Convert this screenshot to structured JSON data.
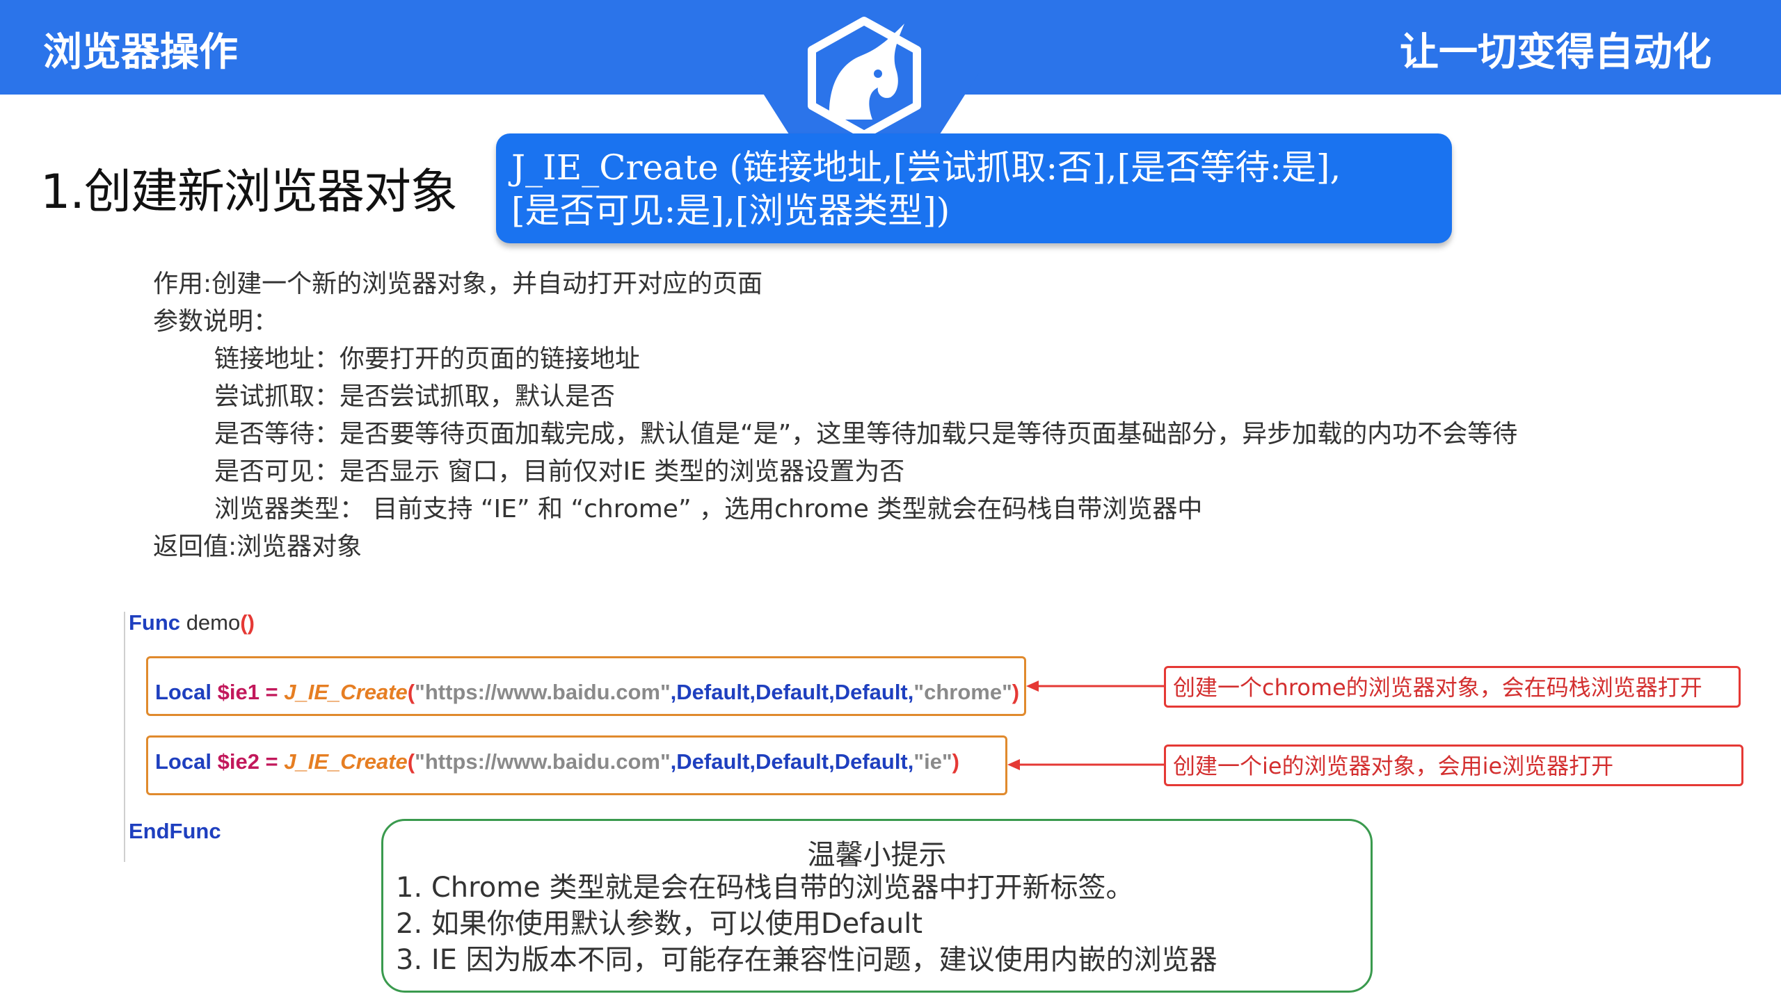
{
  "header": {
    "left_title": "浏览器操作",
    "right_title": "让一切变得自动化",
    "logo": "unicorn-logo-icon"
  },
  "section": {
    "title": "1.创建新浏览器对象",
    "signature_line1": "J_IE_Create (链接地址,[尝试抓取:否],[是否等待:是],",
    "signature_line2": "[是否可见:是],[浏览器类型])"
  },
  "description": {
    "purpose": "作用:创建一个新的浏览器对象，并自动打开对应的页面",
    "params_header": "参数说明：",
    "params": [
      "链接地址：你要打开的页面的链接地址",
      "尝试抓取：是否尝试抓取，默认是否",
      "是否等待：是否要等待页面加载完成，默认值是“是”，这里等待加载只是等待页面基础部分，异步加载的内功不会等待",
      "是否可见：是否显示 窗口，目前仅对IE 类型的浏览器设置为否",
      "浏览器类型：  目前支持 “IE” 和 “chrome” ，选用chrome 类型就会在码栈自带浏览器中"
    ],
    "return_value": "返回值:浏览器对象"
  },
  "code": {
    "func_kw": "Func",
    "func_name": "demo",
    "open_paren": "(",
    "close_paren": ")",
    "line1": {
      "local": "Local",
      "var": "$ie1",
      "eq": " = ",
      "fn": "J_IE_Create",
      "paren_open": "(",
      "url": "\"https://www.baidu.com\"",
      "comma": ",",
      "d1": "Default",
      "d2": "Default",
      "d3": "Default",
      "type": "\"chrome\"",
      "paren_close": ")"
    },
    "line2": {
      "local": "Local",
      "var": "$ie2",
      "eq": " = ",
      "fn": "J_IE_Create",
      "paren_open": "(",
      "url": "\"https://www.baidu.com\"",
      "comma": ",",
      "d1": "Default",
      "d2": "Default",
      "d3": "Default",
      "type": "\"ie\"",
      "paren_close": ")"
    },
    "end_kw": "EndFunc"
  },
  "annotations": {
    "note1": "创建一个chrome的浏览器对象，会在码栈浏览器打开",
    "note2": "创建一个ie的浏览器对象，会用ie浏览器打开"
  },
  "tips": {
    "title": "温馨小提示",
    "items": [
      "1. Chrome 类型就是会在码栈自带的浏览器中打开新标签。",
      "2. 如果你使用默认参数，可以使用Default",
      "3. IE 因为版本不同，可能存在兼容性问题，建议使用内嵌的浏览器"
    ]
  },
  "colors": {
    "banner": "#2b74ea",
    "signature_bg": "#1a73f0",
    "code_keyword": "#1e3fbf",
    "code_variable": "#c2185b",
    "code_function": "#e67e22",
    "code_string": "#8a8a8a",
    "note_border": "#e53935",
    "tips_border": "#3a9a4e"
  }
}
